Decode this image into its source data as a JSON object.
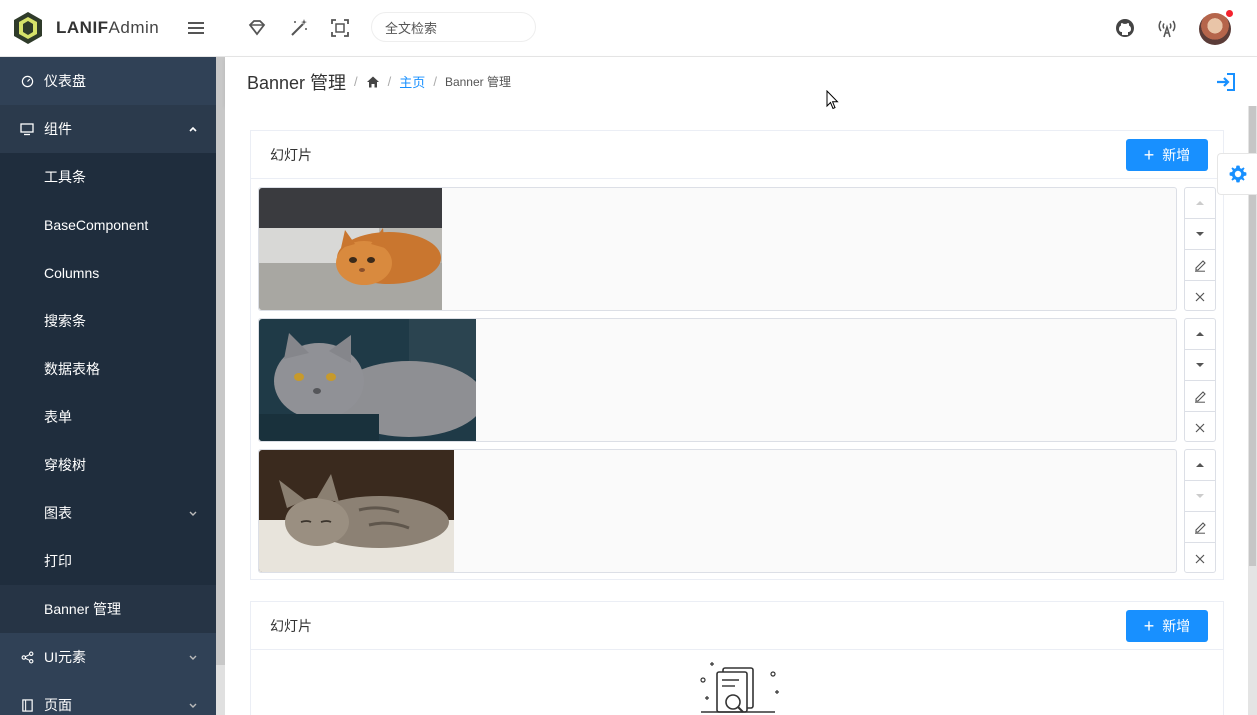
{
  "app": {
    "brand_bold": "LANIF",
    "brand_rest": "Admin"
  },
  "header": {
    "search_placeholder": "全文检索"
  },
  "sidebar": {
    "items": [
      {
        "label": "仪表盘"
      },
      {
        "label": "组件"
      },
      {
        "label": "UI元素"
      },
      {
        "label": "页面"
      }
    ],
    "sub_items": [
      {
        "label": "工具条"
      },
      {
        "label": "BaseComponent"
      },
      {
        "label": "Columns"
      },
      {
        "label": "搜索条"
      },
      {
        "label": "数据表格"
      },
      {
        "label": "表单"
      },
      {
        "label": "穿梭树"
      },
      {
        "label": "图表"
      },
      {
        "label": "打印"
      },
      {
        "label": "Banner 管理"
      }
    ]
  },
  "breadcrumb": {
    "title": "Banner 管理",
    "home_link": "主页",
    "current": "Banner 管理"
  },
  "cards": [
    {
      "title": "幻灯片",
      "add_label": "新增"
    },
    {
      "title": "幻灯片",
      "add_label": "新增"
    }
  ],
  "colors": {
    "primary": "#1890ff",
    "sidebar_bg": "#304156",
    "sidebar_sub_bg": "#1f2d3d"
  }
}
